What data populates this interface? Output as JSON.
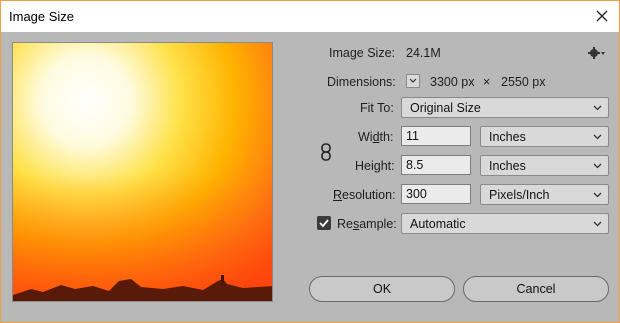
{
  "window": {
    "title": "Image Size"
  },
  "image_size": {
    "label": "Image Size:",
    "value": "24.1M"
  },
  "dimensions": {
    "label": "Dimensions:",
    "width": "3300 px",
    "times": "×",
    "height": "2550 px"
  },
  "fit_to": {
    "label": "Fit To:",
    "value": "Original Size"
  },
  "width": {
    "label_pre": "Wi",
    "label_u": "d",
    "label_post": "th:",
    "value": "11",
    "unit": "Inches"
  },
  "height": {
    "label_pre": "Hei",
    "label_u": "g",
    "label_post": "ht:",
    "value": "8.5",
    "unit": "Inches"
  },
  "resolution": {
    "label_pre": "",
    "label_u": "R",
    "label_post": "esolution:",
    "value": "300",
    "unit": "Pixels/Inch"
  },
  "resample": {
    "label_pre": "Re",
    "label_u": "s",
    "label_post": "ample:",
    "checked": true,
    "value": "Automatic"
  },
  "buttons": {
    "ok": "OK",
    "cancel": "Cancel"
  },
  "icons": {
    "close": "close-icon",
    "gear": "gear-icon",
    "link": "link-icon",
    "chevron": "chevron-down-icon",
    "check": "checkmark-icon"
  },
  "colors": {
    "accent_border": "#f0a040",
    "dialog_bg": "#b8b8b8",
    "preview_top": "#fffbe0",
    "preview_mid": "#ffb300",
    "preview_bottom": "#ff4a10"
  }
}
